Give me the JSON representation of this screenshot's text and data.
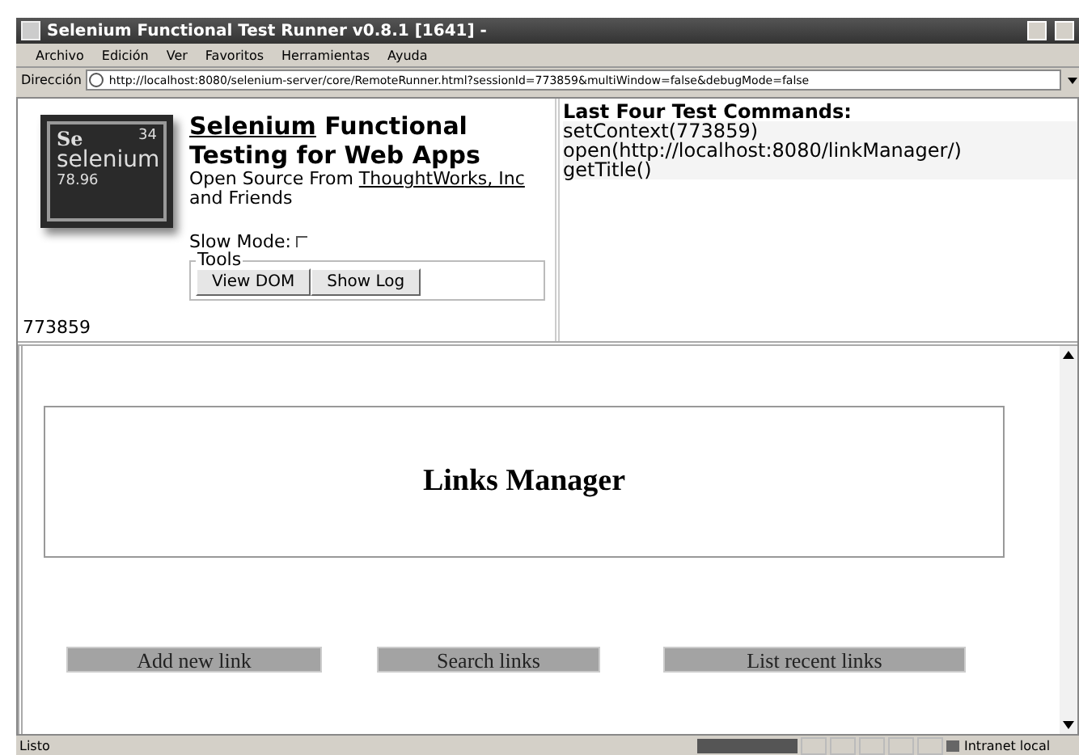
{
  "window": {
    "title": "Selenium Functional Test Runner v0.8.1 [1641] -"
  },
  "menu": [
    "Archivo",
    "Edición",
    "Ver",
    "Favoritos",
    "Herramientas",
    "Ayuda"
  ],
  "address_bar": {
    "label": "Dirección",
    "value": "http://localhost:8080/selenium-server/core/RemoteRunner.html?sessionId=773859&multiWindow=false&debugMode=false"
  },
  "logo": {
    "symbol": "Se",
    "number": "34",
    "name": "selenium",
    "mass": "78.96"
  },
  "header": {
    "title_link": "Selenium",
    "title_rest": "Functional",
    "title_line2": "Testing for Web Apps",
    "subtitle": "Open Source From",
    "subtitle_link": "ThoughtWorks, Inc",
    "subtitle_end": "and Friends"
  },
  "slow_mode": {
    "label": "Slow Mode:",
    "checked": false
  },
  "tools": {
    "legend": "Tools",
    "buttons": [
      "View DOM",
      "Show Log"
    ]
  },
  "session_id": "773859",
  "commands": {
    "heading": "Last Four Test Commands:",
    "items": [
      "setContext(773859)",
      "open(http://localhost:8080/linkManager/)",
      "getTitle()"
    ]
  },
  "page": {
    "heading": "Links Manager",
    "links": [
      "Add new link",
      "Search links",
      "List recent links"
    ]
  },
  "status_bar": {
    "text": "Listo",
    "progress": {
      "level": 1
    },
    "zone": "Intranet local"
  }
}
